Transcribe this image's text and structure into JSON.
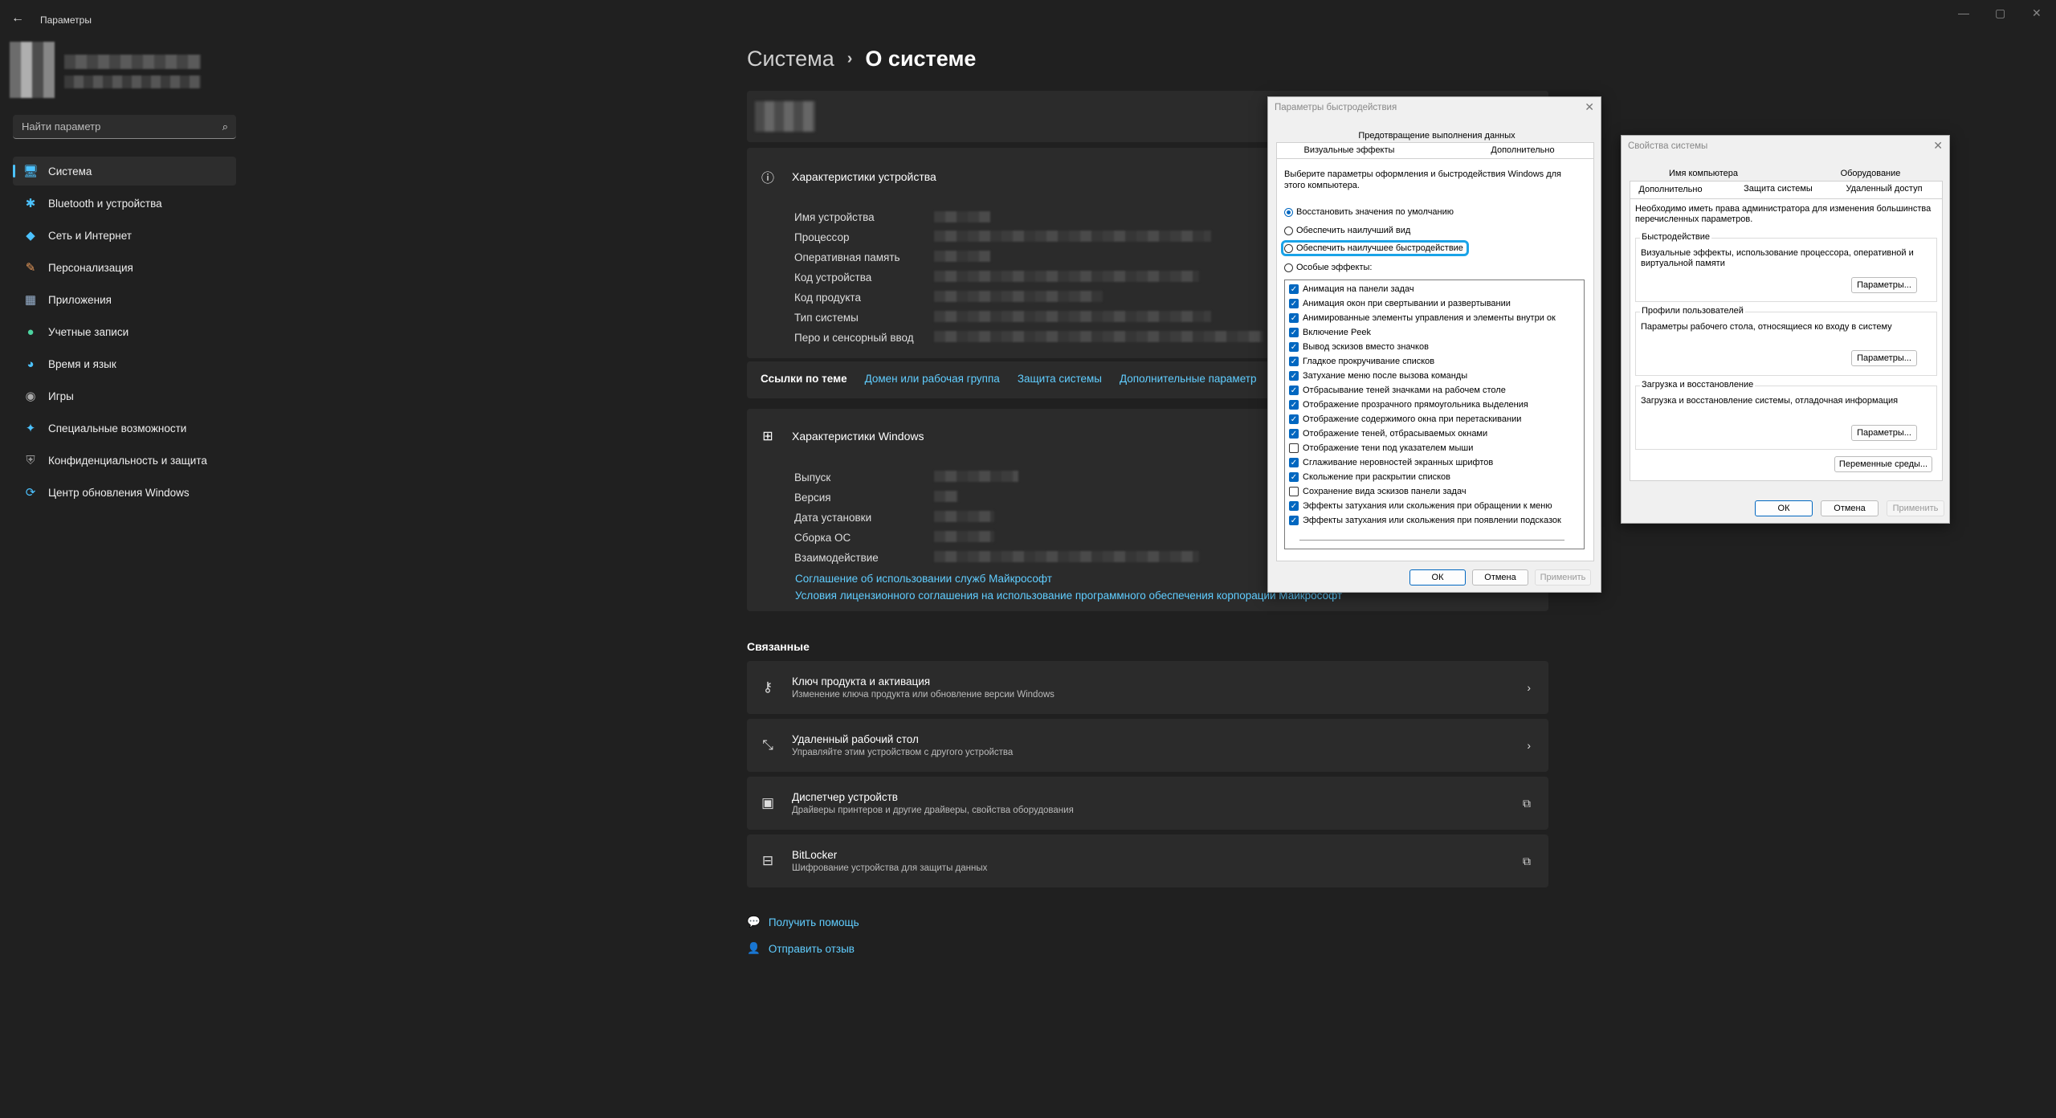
{
  "window": {
    "title": "Параметры",
    "back": "←",
    "minimize": "—",
    "maximize": "▢",
    "close": "✕"
  },
  "search": {
    "placeholder": "Найти параметр"
  },
  "nav": [
    {
      "label": "Система",
      "icon": "🖥"
    },
    {
      "label": "Bluetooth и устройства",
      "icon": "✱"
    },
    {
      "label": "Сеть и Интернет",
      "icon": "◆"
    },
    {
      "label": "Персонализация",
      "icon": "✎"
    },
    {
      "label": "Приложения",
      "icon": "▦"
    },
    {
      "label": "Учетные записи",
      "icon": "●"
    },
    {
      "label": "Время и язык",
      "icon": "◕"
    },
    {
      "label": "Игры",
      "icon": "◉"
    },
    {
      "label": "Специальные возможности",
      "icon": "✦"
    },
    {
      "label": "Конфиденциальность и защита",
      "icon": "⛨"
    },
    {
      "label": "Центр обновления Windows",
      "icon": "⟳"
    }
  ],
  "breadcrumb": {
    "parent": "Система",
    "sep": "›",
    "current": "О системе"
  },
  "device": {
    "title": "Характеристики устройства",
    "labels": [
      "Имя устройства",
      "Процессор",
      "Оперативная память",
      "Код устройства",
      "Код продукта",
      "Тип системы",
      "Перо и сенсорный ввод"
    ]
  },
  "links": {
    "label": "Ссылки по теме",
    "items": [
      "Домен или рабочая группа",
      "Защита системы",
      "Дополнительные параметр"
    ]
  },
  "windows": {
    "title": "Характеристики Windows",
    "labels": [
      "Выпуск",
      "Версия",
      "Дата установки",
      "Сборка ОС",
      "Взаимодействие"
    ],
    "link1": "Соглашение об использовании служб Майкрософт",
    "link2": "Условия лицензионного соглашения на использование программного обеспечения корпорации Майкрософт"
  },
  "related": {
    "title": "Связанные",
    "items": [
      {
        "title": "Ключ продукта и активация",
        "sub": "Изменение ключа продукта или обновление версии Windows",
        "icon": "⚷",
        "action": "›"
      },
      {
        "title": "Удаленный рабочий стол",
        "sub": "Управляйте этим устройством с другого устройства",
        "icon": "⤡",
        "action": "›"
      },
      {
        "title": "Диспетчер устройств",
        "sub": "Драйверы принтеров и другие драйверы, свойства оборудования",
        "icon": "▣",
        "action": "⧉"
      },
      {
        "title": "BitLocker",
        "sub": "Шифрование устройства для защиты данных",
        "icon": "⊟",
        "action": "⧉"
      }
    ]
  },
  "help": {
    "get_help": "Получить помощь",
    "feedback": "Отправить отзыв"
  },
  "perf_dialog": {
    "title": "Параметры быстродействия",
    "tab_top": "Предотвращение выполнения данных",
    "tab_visual": "Визуальные эффекты",
    "tab_advanced": "Дополнительно",
    "intro": "Выберите параметры оформления и быстродействия Windows для этого компьютера.",
    "radios": [
      "Восстановить значения по умолчанию",
      "Обеспечить наилучший вид",
      "Обеспечить наилучшее быстродействие",
      "Особые эффекты:"
    ],
    "selected_radio": 0,
    "effects": [
      {
        "label": "Анимация на панели задач",
        "checked": true
      },
      {
        "label": "Анимация окон при свертывании и развертывании",
        "checked": true
      },
      {
        "label": "Анимированные элементы управления и элементы внутри ок",
        "checked": true
      },
      {
        "label": "Включение Peek",
        "checked": true
      },
      {
        "label": "Вывод эскизов вместо значков",
        "checked": true
      },
      {
        "label": "Гладкое прокручивание списков",
        "checked": true
      },
      {
        "label": "Затухание меню после вызова команды",
        "checked": true
      },
      {
        "label": "Отбрасывание теней значками на рабочем столе",
        "checked": true
      },
      {
        "label": "Отображение прозрачного прямоугольника выделения",
        "checked": true
      },
      {
        "label": "Отображение содержимого окна при перетаскивании",
        "checked": true
      },
      {
        "label": "Отображение теней, отбрасываемых окнами",
        "checked": true
      },
      {
        "label": "Отображение тени под указателем мыши",
        "checked": false
      },
      {
        "label": "Сглаживание неровностей экранных шрифтов",
        "checked": true
      },
      {
        "label": "Скольжение при раскрытии списков",
        "checked": true
      },
      {
        "label": "Сохранение вида эскизов панели задач",
        "checked": false
      },
      {
        "label": "Эффекты затухания или скольжения при обращении к меню",
        "checked": true
      },
      {
        "label": "Эффекты затухания или скольжения при появлении подсказок",
        "checked": true
      }
    ],
    "ok": "ОК",
    "cancel": "Отмена",
    "apply": "Применить"
  },
  "sys_dialog": {
    "title": "Свойства системы",
    "tabs_top": [
      "Имя компьютера",
      "Оборудование"
    ],
    "tabs_bottom": [
      "Дополнительно",
      "Защита системы",
      "Удаленный доступ"
    ],
    "admin_note": "Необходимо иметь права администратора для изменения большинства перечисленных параметров.",
    "groups": [
      {
        "title": "Быстродействие",
        "text": "Визуальные эффекты, использование процессора, оперативной и виртуальной памяти",
        "button": "Параметры..."
      },
      {
        "title": "Профили пользователей",
        "text": "Параметры рабочего стола, относящиеся ко входу в систему",
        "button": "Параметры..."
      },
      {
        "title": "Загрузка и восстановление",
        "text": "Загрузка и восстановление системы, отладочная информация",
        "button": "Параметры..."
      }
    ],
    "env_button": "Переменные среды...",
    "ok": "ОК",
    "cancel": "Отмена",
    "apply": "Применить"
  }
}
